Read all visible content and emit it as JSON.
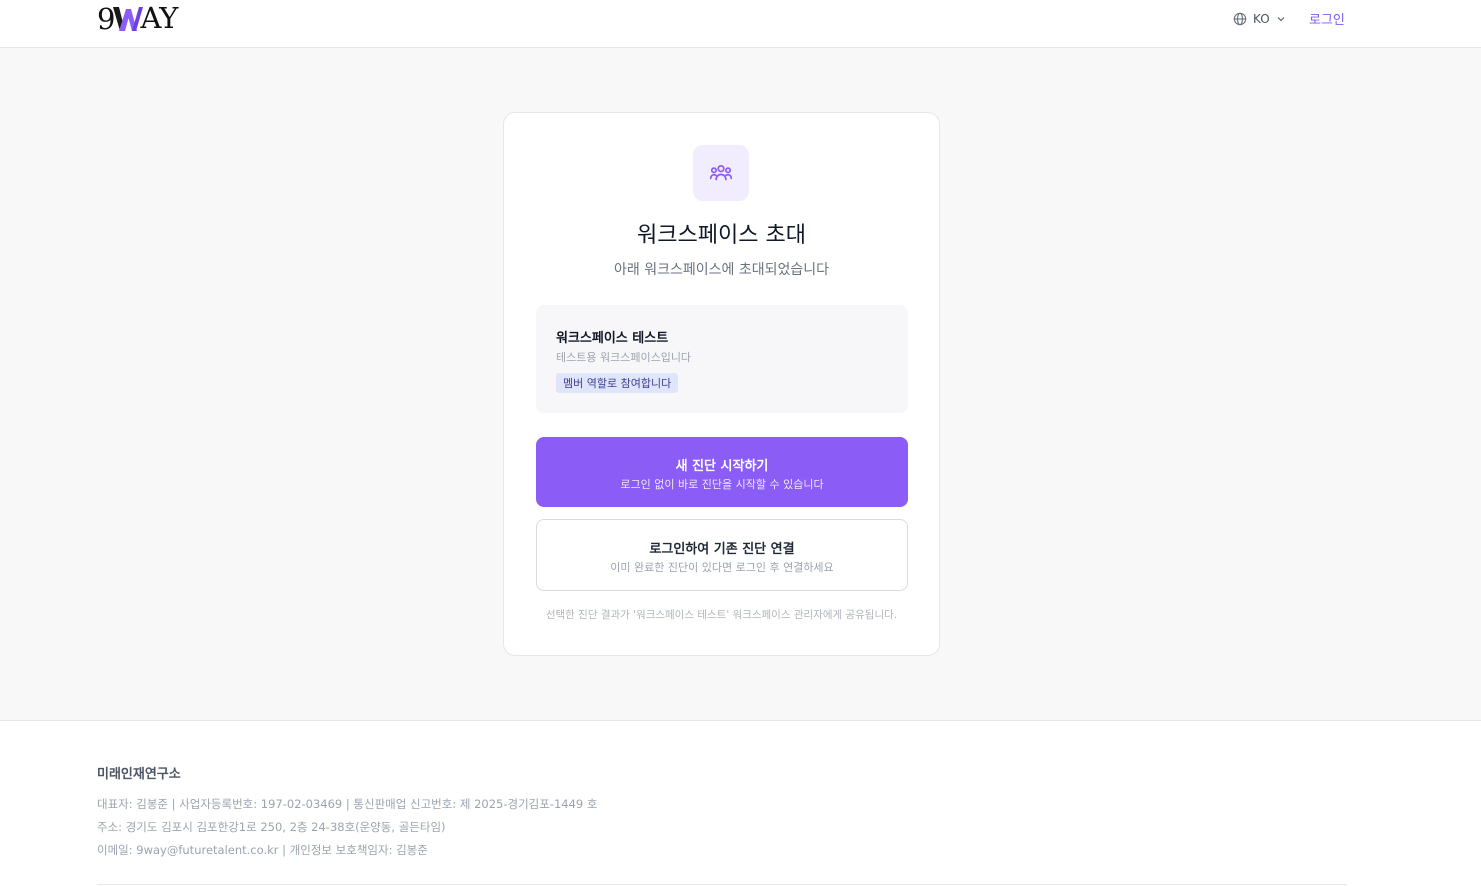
{
  "header": {
    "logo_text_left": "9",
    "logo_text_right": "AY",
    "language": "KO",
    "login_label": "로그인"
  },
  "card": {
    "icon": "users-group-icon",
    "title": "워크스페이스 초대",
    "subtitle": "아래 워크스페이스에 초대되었습니다",
    "workspace": {
      "name": "워크스페이스 테스트",
      "description": "테스트용 워크스페이스입니다",
      "role_badge": "멤버 역할로 참여합니다"
    },
    "primary_button": {
      "title": "새 진단 시작하기",
      "subtitle": "로그인 없이 바로 진단을 시작할 수 있습니다"
    },
    "secondary_button": {
      "title": "로그인하여 기존 진단 연결",
      "subtitle": "이미 완료한 진단이 있다면 로그인 후 연결하세요"
    },
    "notice": "선택한 진단 결과가 '워크스페이스 테스트' 워크스페이스 관리자에게 공유됩니다."
  },
  "footer": {
    "company": "미래인재연구소",
    "line1": "대표자: 김봉준 | 사업자등록번호: 197-02-03469 | 통신판매업 신고번호: 제 2025-경기김포-1449 호",
    "line2": "주소: 경기도 김포시 김포한강1로 250, 2층 24-38호(운양동, 골든타임)",
    "line3": "이메일: 9way@futuretalent.co.kr | 개인정보 보호책임자: 김봉준"
  },
  "colors": {
    "accent": "#8b5cf6",
    "accent_soft": "#f1ecfe",
    "badge_bg": "#e1e5fb",
    "page_bg": "#f8f8f9"
  }
}
